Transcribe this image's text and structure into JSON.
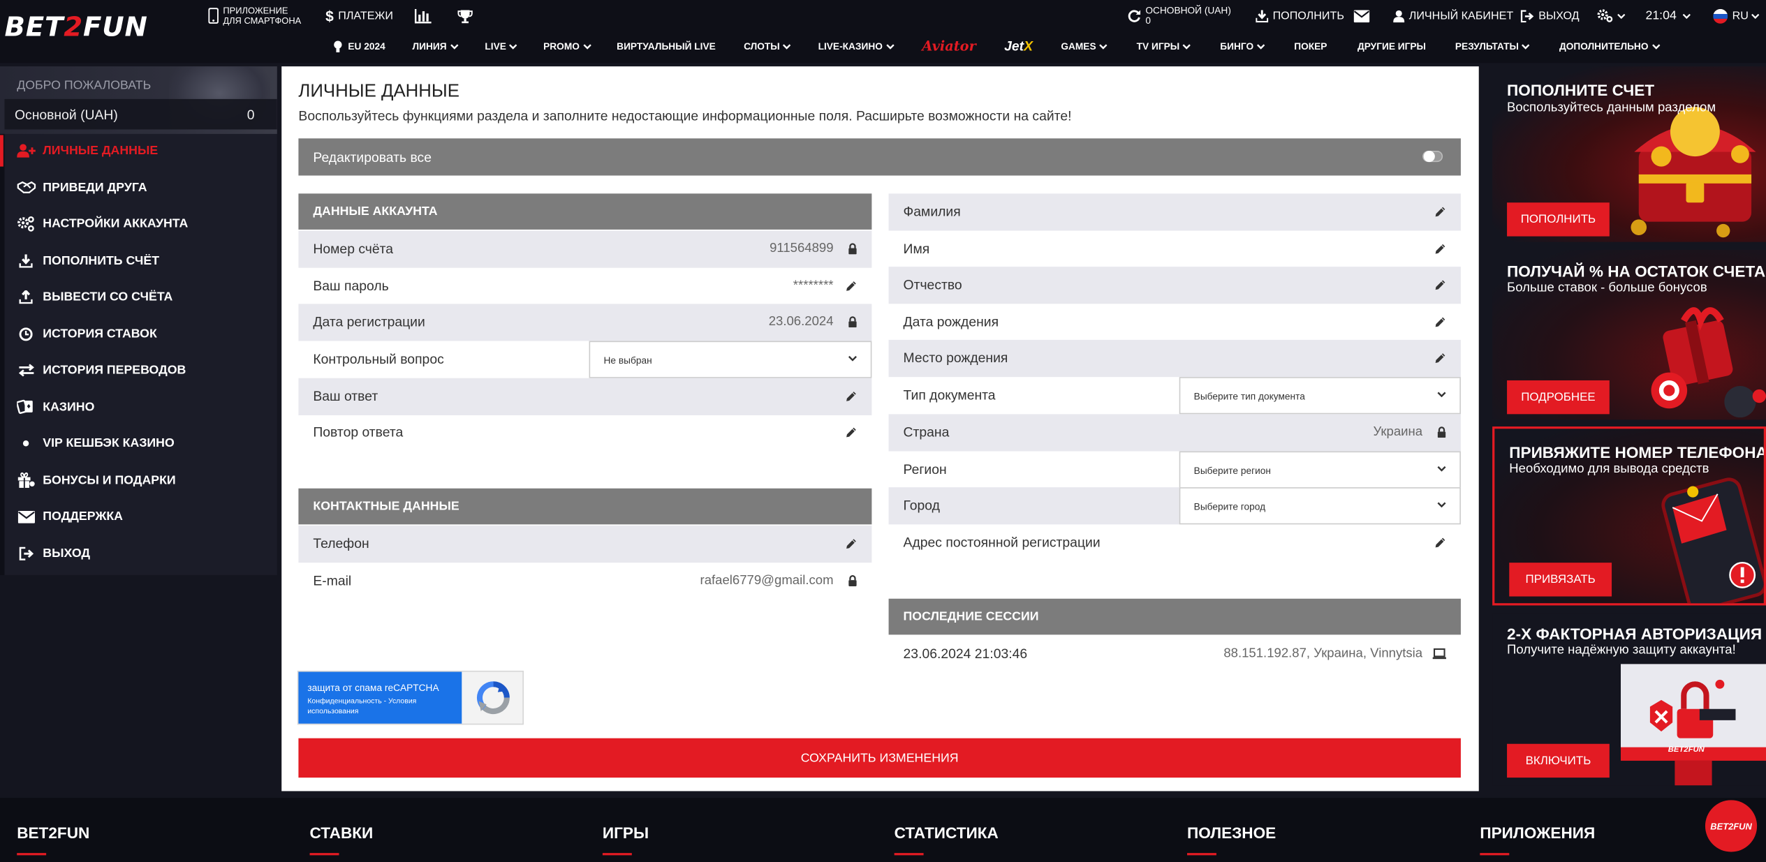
{
  "header": {
    "logo": {
      "pre": "BET",
      "mid": "2",
      "post": "FUN"
    },
    "app": {
      "line1": "ПРИЛОЖЕНИЕ",
      "line2": "ДЛЯ СМАРТФОНА"
    },
    "payments": "ПЛАТЕЖИ",
    "balance": {
      "label": "ОСНОВНОЙ (UAH)",
      "value": "0"
    },
    "deposit": "ПОПОЛНИТЬ",
    "cabinet": "ЛИЧНЫЙ КАБИНЕТ",
    "exit": "ВЫХОД",
    "time": "21:04",
    "lang": "RU"
  },
  "menu": {
    "items": [
      {
        "label": "EU 2024"
      },
      {
        "label": "ЛИНИЯ"
      },
      {
        "label": "LIVE"
      },
      {
        "label": "PROMO"
      },
      {
        "label": "ВИРТУАЛЬНЫЙ LIVE"
      },
      {
        "label": "СЛОТЫ"
      },
      {
        "label": "LIVE-КАЗИНО"
      },
      {
        "label": "Aviator"
      },
      {
        "label": "Jet",
        "suffix": "X"
      },
      {
        "label": "GAMES"
      },
      {
        "label": "TV ИГРЫ"
      },
      {
        "label": "БИНГО"
      },
      {
        "label": "ПОКЕР"
      },
      {
        "label": "ДРУГИЕ ИГРЫ"
      },
      {
        "label": "РЕЗУЛЬТАТЫ"
      },
      {
        "label": "ДОПОЛНИТЕЛЬНО"
      }
    ]
  },
  "sidebar": {
    "welcome": "ДОБРО ПОЖАЛОВАТЬ",
    "balance_name": "Основной (UAH)",
    "balance_amount": "0",
    "items": [
      {
        "label": "ЛИЧНЫЕ ДАННЫЕ",
        "icon": "add-user-icon",
        "active": true
      },
      {
        "label": "ПРИВЕДИ ДРУГА",
        "icon": "handshake-icon"
      },
      {
        "label": "НАСТРОЙКИ АККАУНТА",
        "icon": "gears-icon"
      },
      {
        "label": "ПОПОЛНИТЬ СЧЁТ",
        "icon": "download-icon"
      },
      {
        "label": "ВЫВЕСТИ СО СЧЁТА",
        "icon": "upload-icon"
      },
      {
        "label": "ИСТОРИЯ СТАВОК",
        "icon": "clock-icon"
      },
      {
        "label": "ИСТОРИЯ ПЕРЕВОДОВ",
        "icon": "transfer-icon"
      },
      {
        "label": "КАЗИНО",
        "icon": "cards-icon"
      },
      {
        "label": "VIP КЕШБЭК КАЗИНО",
        "icon": "dot-icon"
      },
      {
        "label": "БОНУСЫ И ПОДАРКИ",
        "icon": "gift-icon"
      },
      {
        "label": "ПОДДЕРЖКА",
        "icon": "mail-icon"
      },
      {
        "label": "ВЫХОД",
        "icon": "sign-out-icon"
      }
    ]
  },
  "main": {
    "title": "ЛИЧНЫЕ ДАННЫЕ",
    "subtitle": "Воспользуйтесь функциями раздела и заполните недостающие информационные поля. Расширьте возможности на сайте!",
    "edit_all": "Редактировать все",
    "account_section": "ДАННЫЕ АККАУНТА",
    "account_rows": [
      {
        "label": "Номер счёта",
        "value": "911564899",
        "action": "lock-icon"
      },
      {
        "label": "Ваш пароль",
        "value": "********",
        "action": "pencil-icon"
      },
      {
        "label": "Дата регистрации",
        "value": "23.06.2024",
        "action": "lock-icon"
      },
      {
        "label": "Контрольный вопрос",
        "select": "Не выбран"
      },
      {
        "label": "Ваш ответ",
        "value": "",
        "action": "pencil-icon"
      },
      {
        "label": "Повтор ответа",
        "value": "",
        "action": "pencil-icon"
      }
    ],
    "contact_section": "КОНТАКТНЫЕ ДАННЫЕ",
    "contact_rows": [
      {
        "label": "Телефон",
        "value": "",
        "action": "pencil-icon"
      },
      {
        "label": "E-mail",
        "value": "rafael6779@gmail.com",
        "action": "lock-icon"
      }
    ],
    "personal_rows": [
      {
        "label": "Фамилия",
        "value": "",
        "action": "pencil-icon"
      },
      {
        "label": "Имя",
        "value": "",
        "action": "pencil-icon"
      },
      {
        "label": "Отчество",
        "value": "",
        "action": "pencil-icon"
      },
      {
        "label": "Дата рождения",
        "value": "",
        "action": "pencil-icon"
      },
      {
        "label": "Место рождения",
        "value": "",
        "action": "pencil-icon"
      },
      {
        "label": "Тип документа",
        "select": "Выберите тип документа"
      },
      {
        "label": "Страна",
        "value": "Украина",
        "action": "lock-icon"
      },
      {
        "label": "Регион",
        "select": "Выберите регион"
      },
      {
        "label": "Город",
        "select": "Выберите город"
      },
      {
        "label": "Адрес постоянной регистрации",
        "value": "",
        "action": "pencil-icon"
      }
    ],
    "sessions_section": "ПОСЛЕДНИЕ СЕССИИ",
    "sessions": [
      {
        "time": "23.06.2024 21:03:46",
        "info": "88.151.192.87, Украина, Vinnytsia"
      }
    ],
    "captcha": {
      "title": "защита от спама reCAPTCHA",
      "links": "Конфиденциальность - Условия использования"
    },
    "save_button": "СОХРАНИТЬ ИЗМЕНЕНИЯ"
  },
  "banners": [
    {
      "title": "ПОПОЛНИТЕ СЧЕТ",
      "subtitle": "Воспользуйтесь данным разделом",
      "button": "ПОПОЛНИТЬ"
    },
    {
      "title": "ПОЛУЧАЙ % НА ОСТАТОК СЧЕТА",
      "subtitle": "Больше ставок - больше бонусов",
      "button": "ПОДРОБНЕЕ"
    },
    {
      "title": "ПРИВЯЖИТЕ НОМЕР ТЕЛЕФОНА",
      "subtitle": "Необходимо для вывода средств",
      "button": "ПРИВЯЗАТЬ"
    },
    {
      "title": "2-Х ФАКТОРНАЯ АВТОРИЗАЦИЯ",
      "subtitle": "Получите надёжную защиту аккаунта!",
      "button": "ВКЛЮЧИТЬ",
      "logo": "BET2FUN"
    }
  ],
  "footer": {
    "columns": [
      "BET2FUN",
      "СТАВКИ",
      "ИГРЫ",
      "СТАТИСТИКА",
      "ПОЛЕЗНОЕ",
      "ПРИЛОЖЕНИЯ"
    ],
    "badge": "BET2FUN"
  },
  "colors": {
    "accent": "#e31b23",
    "dark_bg": "#14151f",
    "header_bg": "#0e0f17",
    "row_alt": "#e8e8ee",
    "section_gray": "#7c7c7c"
  }
}
